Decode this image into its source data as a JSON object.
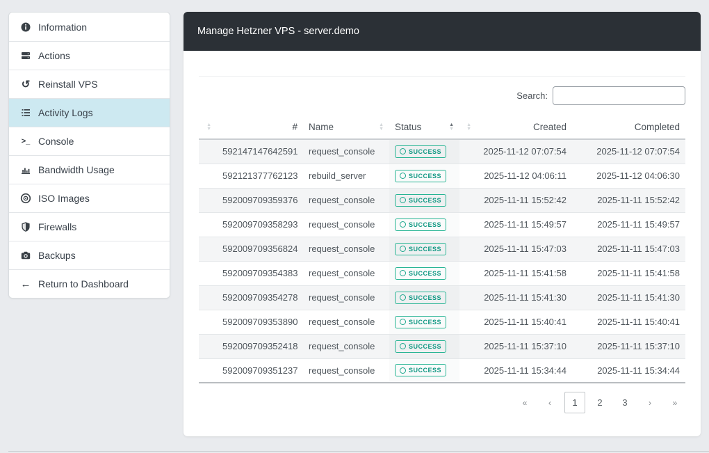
{
  "panel": {
    "title": "Manage Hetzner VPS - server.demo",
    "search_label": "Search:",
    "search_value": ""
  },
  "sidebar": {
    "items": [
      {
        "label": "Information",
        "icon": "info-icon",
        "active": false
      },
      {
        "label": "Actions",
        "icon": "server-icon",
        "active": false
      },
      {
        "label": "Reinstall VPS",
        "icon": "undo-icon",
        "active": false
      },
      {
        "label": "Activity Logs",
        "icon": "list-icon",
        "active": true
      },
      {
        "label": "Console",
        "icon": "terminal-icon",
        "active": false
      },
      {
        "label": "Bandwidth Usage",
        "icon": "bar-chart-icon",
        "active": false
      },
      {
        "label": "ISO Images",
        "icon": "disc-icon",
        "active": false
      },
      {
        "label": "Firewalls",
        "icon": "shield-icon",
        "active": false
      },
      {
        "label": "Backups",
        "icon": "camera-icon",
        "active": false
      },
      {
        "label": "Return to Dashboard",
        "icon": "arrow-left-icon",
        "active": false
      }
    ]
  },
  "table": {
    "columns": [
      {
        "label": "",
        "align": "left",
        "sort": "both",
        "width": 26
      },
      {
        "label": "#",
        "align": "right",
        "sort": "none",
        "width": 124
      },
      {
        "label": "Name",
        "align": "left",
        "sort": "both",
        "width": 124
      },
      {
        "label": "Status",
        "align": "left",
        "sort": "asc",
        "width": 101
      },
      {
        "label": "",
        "align": "left",
        "sort": "both",
        "width": 25
      },
      {
        "label": "Created",
        "align": "right",
        "sort": "none",
        "width": 137
      },
      {
        "label": "Completed",
        "align": "right",
        "sort": "none",
        "width": 163
      }
    ],
    "rows": [
      {
        "id": "592147147642591",
        "name": "request_console",
        "status": "SUCCESS",
        "created": "2025-11-12 07:07:54",
        "completed": "2025-11-12 07:07:54"
      },
      {
        "id": "592121377762123",
        "name": "rebuild_server",
        "status": "SUCCESS",
        "created": "2025-11-12 04:06:11",
        "completed": "2025-11-12 04:06:30"
      },
      {
        "id": "592009709359376",
        "name": "request_console",
        "status": "SUCCESS",
        "created": "2025-11-11 15:52:42",
        "completed": "2025-11-11 15:52:42"
      },
      {
        "id": "592009709358293",
        "name": "request_console",
        "status": "SUCCESS",
        "created": "2025-11-11 15:49:57",
        "completed": "2025-11-11 15:49:57"
      },
      {
        "id": "592009709356824",
        "name": "request_console",
        "status": "SUCCESS",
        "created": "2025-11-11 15:47:03",
        "completed": "2025-11-11 15:47:03"
      },
      {
        "id": "592009709354383",
        "name": "request_console",
        "status": "SUCCESS",
        "created": "2025-11-11 15:41:58",
        "completed": "2025-11-11 15:41:58"
      },
      {
        "id": "592009709354278",
        "name": "request_console",
        "status": "SUCCESS",
        "created": "2025-11-11 15:41:30",
        "completed": "2025-11-11 15:41:30"
      },
      {
        "id": "592009709353890",
        "name": "request_console",
        "status": "SUCCESS",
        "created": "2025-11-11 15:40:41",
        "completed": "2025-11-11 15:40:41"
      },
      {
        "id": "592009709352418",
        "name": "request_console",
        "status": "SUCCESS",
        "created": "2025-11-11 15:37:10",
        "completed": "2025-11-11 15:37:10"
      },
      {
        "id": "592009709351237",
        "name": "request_console",
        "status": "SUCCESS",
        "created": "2025-11-11 15:34:44",
        "completed": "2025-11-11 15:34:44"
      }
    ]
  },
  "pagination": {
    "items": [
      {
        "label": "«",
        "kind": "first",
        "active": false
      },
      {
        "label": "‹",
        "kind": "prev",
        "active": false
      },
      {
        "label": "1",
        "kind": "page",
        "active": true
      },
      {
        "label": "2",
        "kind": "page",
        "active": false
      },
      {
        "label": "3",
        "kind": "page",
        "active": false
      },
      {
        "label": "›",
        "kind": "next",
        "active": false
      },
      {
        "label": "»",
        "kind": "last",
        "active": false
      }
    ]
  },
  "colors": {
    "page_bg": "#e9ebee",
    "header_bg": "#2b3036",
    "active_item_bg": "#cde9f1",
    "success_accent": "#1aa78c"
  }
}
